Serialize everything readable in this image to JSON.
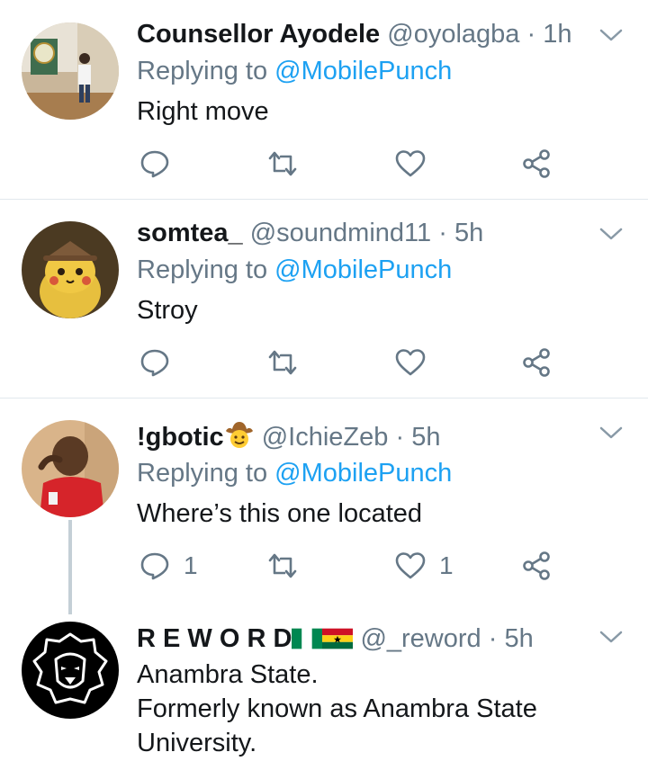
{
  "colors": {
    "text_primary": "#14171a",
    "text_secondary": "#657786",
    "link": "#1da1f2",
    "divider": "#e1e8ed"
  },
  "replying_label": "Replying to",
  "tweets": [
    {
      "display_name": "Counsellor Ayodele",
      "handle": "@oyolagba",
      "separator": "·",
      "time": "1h",
      "reply_to": "@MobilePunch",
      "text": "Right move",
      "avatar": "avatar-photo-man-standing",
      "reply_count": "",
      "like_count": ""
    },
    {
      "display_name": "somtea_",
      "handle": "@soundmind11",
      "separator": "·",
      "time": "5h",
      "reply_to": "@MobilePunch",
      "text": "Stroy",
      "avatar": "avatar-detective-pikachu",
      "reply_count": "",
      "like_count": ""
    },
    {
      "display_name": "!gbotic",
      "name_emoji": "cowboy-face-emoji",
      "handle": "@IchieZeb",
      "separator": "·",
      "time": "5h",
      "reply_to": "@MobilePunch",
      "text": "Where’s this one located",
      "avatar": "avatar-man-red-shirt",
      "reply_count": "1",
      "like_count": "1"
    },
    {
      "display_name": "R E W O R D",
      "name_emoji": "nigeria-flag ghana-flag",
      "handle": "@_reword",
      "separator": "·",
      "time": "5h",
      "text_lines": [
        "Anambra State.",
        "Formerly known as Anambra State",
        "University."
      ],
      "avatar": "avatar-lion-logo"
    }
  ]
}
